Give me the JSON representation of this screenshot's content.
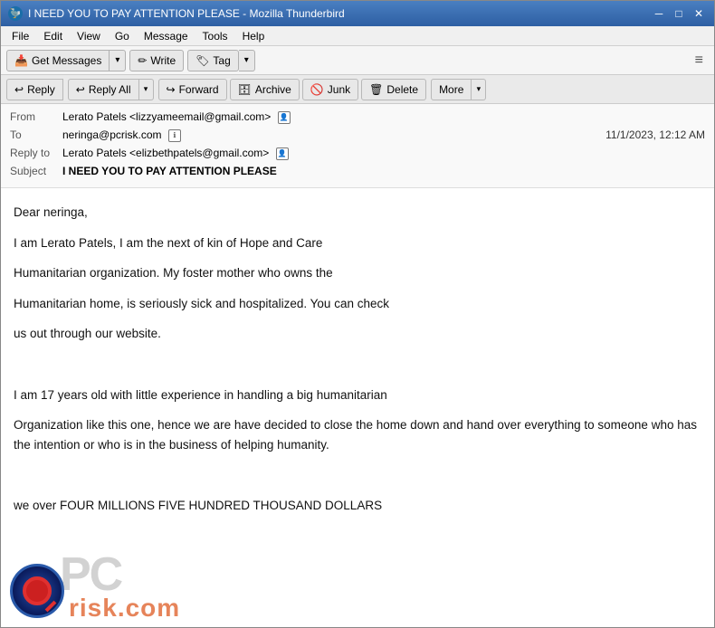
{
  "window": {
    "title": "I NEED YOU TO PAY ATTENTION PLEASE - Mozilla Thunderbird",
    "icon": "🦤"
  },
  "title_controls": {
    "minimize": "─",
    "maximize": "□",
    "close": "✕"
  },
  "menu": {
    "items": [
      "File",
      "Edit",
      "View",
      "Go",
      "Message",
      "Tools",
      "Help"
    ]
  },
  "toolbar1": {
    "get_messages": "Get Messages",
    "write": "Write",
    "tag": "Tag",
    "hamburger": "≡"
  },
  "toolbar2": {
    "reply": "Reply",
    "reply_all": "Reply All",
    "forward": "Forward",
    "archive": "Archive",
    "junk": "Junk",
    "delete": "Delete",
    "more": "More"
  },
  "email": {
    "from_label": "From",
    "from_value": "Lerato Patels <lizzyameemail@gmail.com>",
    "to_label": "To",
    "to_value": "neringa@pcrisk.com",
    "date": "11/1/2023, 12:12 AM",
    "reply_to_label": "Reply to",
    "reply_to_value": "Lerato Patels <elizbethpatels@gmail.com>",
    "subject_label": "Subject",
    "subject_value": "I NEED YOU TO PAY ATTENTION PLEASE",
    "body_lines": [
      "Dear neringa,",
      "I am Lerato Patels, I am the next of kin of Hope and Care",
      "Humanitarian organization. My foster mother who owns the",
      "Humanitarian home, is seriously sick and hospitalized. You can check",
      "us out through our website.",
      "",
      "I am 17 years old with little experience in handling a big humanitarian",
      "Organization like this one, hence we are have decided to close the home down and hand over everything to someone who has the intention or who is in the business of helping humanity.",
      "",
      "we over FOUR MILLIONS FIVE HUNDRED THOUSAND DOLLARS"
    ]
  },
  "icons": {
    "reply_icon": "↩",
    "reply_all_icon": "↩↩",
    "forward_icon": "↪",
    "archive_icon": "🗄",
    "junk_icon": "🚫",
    "delete_icon": "🗑",
    "get_messages_icon": "📥",
    "write_icon": "✏",
    "tag_icon": "🏷",
    "chevron_down": "▾",
    "info_icon": "ℹ",
    "address_icon": "👤"
  },
  "watermark": {
    "pc": "PC",
    "risk": "risk.com"
  }
}
